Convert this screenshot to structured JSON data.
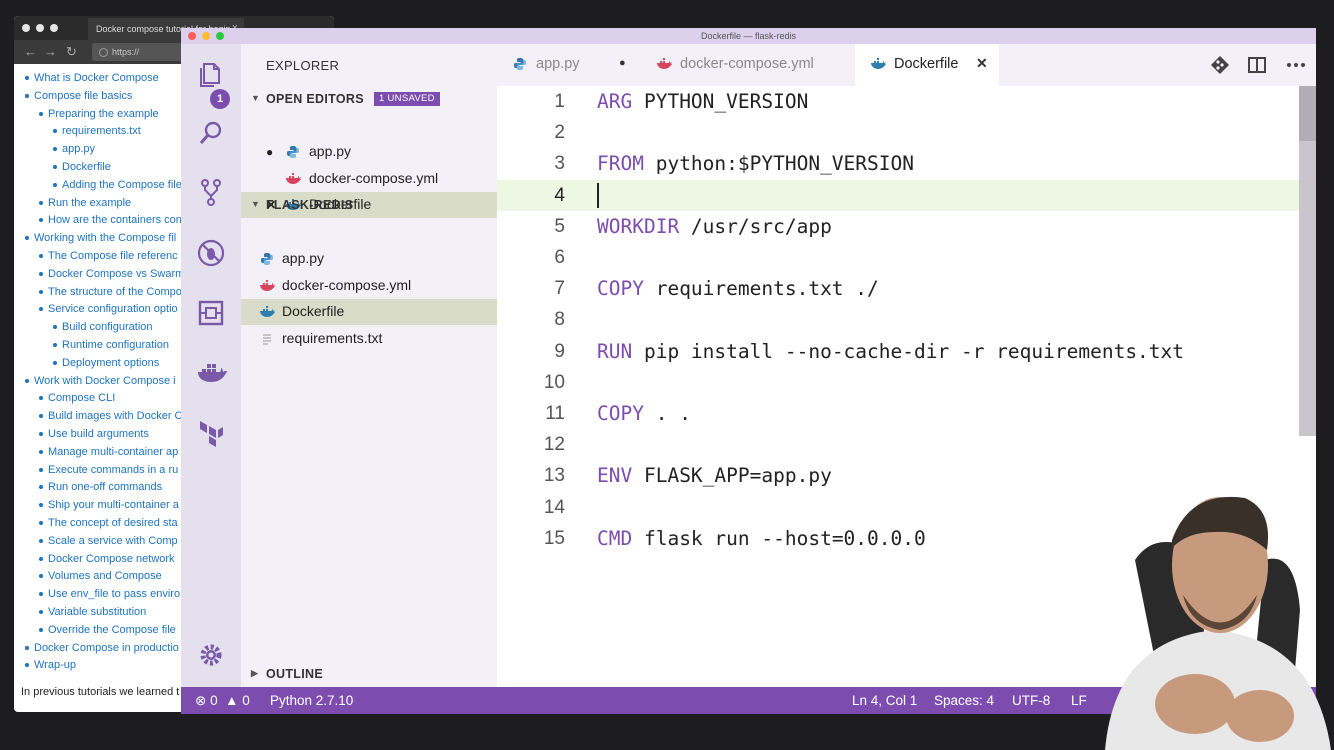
{
  "browser": {
    "tab_title": "Docker compose tutorial for begin",
    "url": "https://",
    "toc": [
      "What is Docker Compose",
      "Compose file basics",
      "Preparing the example",
      "requirements.txt",
      "app.py",
      "Dockerfile",
      "Adding the Compose file",
      "Run the example",
      "How are the containers con",
      "Working with the Compose fil",
      "The Compose file referenc",
      "Docker Compose vs Swarm",
      "The structure of the Compo",
      "Service configuration optio",
      "Build configuration",
      "Runtime configuration",
      "Deployment options",
      "Work with Docker Compose i",
      "Compose CLI",
      "Build images with Docker C",
      "Use build arguments",
      "Manage multi-container ap",
      "Execute commands in a ru",
      "Run one-off commands",
      "Ship your multi-container a",
      "The concept of desired sta",
      "Scale a service with Comp",
      "Docker Compose network",
      "Volumes and Compose",
      "Use env_file to pass enviro",
      "Variable substitution",
      "Override the Compose file",
      "Docker Compose in productio",
      "Wrap-up"
    ],
    "toc_levels": [
      1,
      1,
      2,
      3,
      3,
      3,
      3,
      2,
      2,
      1,
      2,
      2,
      2,
      2,
      3,
      3,
      3,
      1,
      2,
      2,
      2,
      2,
      2,
      2,
      2,
      2,
      2,
      2,
      2,
      2,
      2,
      2,
      1,
      1
    ],
    "footer_text": "In previous tutorials we learned t"
  },
  "window": {
    "title": "Dockerfile — flask-redis"
  },
  "activity_bar": {
    "icons": [
      "files-icon",
      "search-icon",
      "source-control-icon",
      "debug-icon",
      "extensions-icon",
      "docker-icon",
      "terraform-icon",
      "settings-gear-icon"
    ],
    "badge": "1"
  },
  "sidebar": {
    "title": "EXPLORER",
    "open_editors": {
      "label": "OPEN EDITORS",
      "badge": "1 UNSAVED",
      "files": [
        {
          "mark": "●",
          "name": "app.py",
          "icon": "python-icon"
        },
        {
          "mark": "",
          "name": "docker-compose.yml",
          "icon": "docker-icon"
        },
        {
          "mark": "✕",
          "name": "Dockerfile",
          "icon": "docker-icon"
        }
      ]
    },
    "project": {
      "label": "FLASK-REDIS",
      "files": [
        {
          "name": "app.py",
          "icon": "python-icon"
        },
        {
          "name": "docker-compose.yml",
          "icon": "docker-icon"
        },
        {
          "name": "Dockerfile",
          "icon": "docker-icon"
        },
        {
          "name": "requirements.txt",
          "icon": "text-file-icon"
        }
      ]
    },
    "outline_label": "OUTLINE"
  },
  "tabs": [
    {
      "name": "app.py",
      "icon": "python-icon",
      "status": "●"
    },
    {
      "name": "docker-compose.yml",
      "icon": "docker-icon",
      "status": ""
    },
    {
      "name": "Dockerfile",
      "icon": "docker-icon",
      "status": "✕"
    }
  ],
  "editor": {
    "current_line": 4,
    "lines": [
      {
        "n": "1",
        "kw": "ARG",
        "rest": " PYTHON_VERSION"
      },
      {
        "n": "2",
        "kw": "",
        "rest": ""
      },
      {
        "n": "3",
        "kw": "FROM",
        "rest": " python:$PYTHON_VERSION"
      },
      {
        "n": "4",
        "kw": "",
        "rest": ""
      },
      {
        "n": "5",
        "kw": "WORKDIR",
        "rest": " /usr/src/app"
      },
      {
        "n": "6",
        "kw": "",
        "rest": ""
      },
      {
        "n": "7",
        "kw": "COPY",
        "rest": " requirements.txt ./"
      },
      {
        "n": "8",
        "kw": "",
        "rest": ""
      },
      {
        "n": "9",
        "kw": "RUN",
        "rest": " pip install --no-cache-dir -r requirements.txt"
      },
      {
        "n": "10",
        "kw": "",
        "rest": ""
      },
      {
        "n": "11",
        "kw": "COPY",
        "rest": " . ."
      },
      {
        "n": "12",
        "kw": "",
        "rest": ""
      },
      {
        "n": "13",
        "kw": "ENV",
        "rest": " FLASK_APP=app.py"
      },
      {
        "n": "14",
        "kw": "",
        "rest": ""
      },
      {
        "n": "15",
        "kw": "CMD",
        "rest": " flask run --host=0.0.0.0"
      }
    ]
  },
  "status_bar": {
    "errors": "0",
    "warnings": "0",
    "interpreter": "Python 2.7.10",
    "position": "Ln 4, Col 1",
    "spaces": "Spaces: 4",
    "encoding": "UTF-8",
    "eol": "LF"
  },
  "colors": {
    "accent": "#7c4dae",
    "keyword": "#7c4dae",
    "selected_row": "#d8dcc8",
    "current_line": "#eef6e4"
  }
}
